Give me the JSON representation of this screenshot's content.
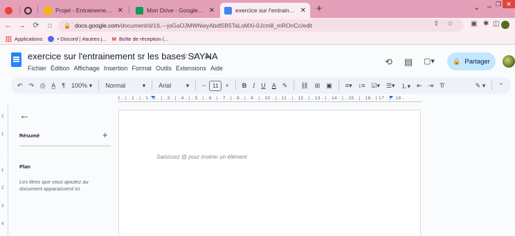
{
  "browser": {
    "tabs": [
      {
        "title": "Projet - Entrainement sur les ba...",
        "active": false,
        "favicon_color": "#f4b400"
      },
      {
        "title": "Mon Drive - Google Drive",
        "active": false,
        "favicon_color": "#0f9d58"
      },
      {
        "title": "exercice sur l'entrainement sr les",
        "active": true,
        "favicon_color": "#4285f4"
      }
    ],
    "url_host": "docs.google.com",
    "url_path": "/document/d/1IL---joGaOJMWNwyAbdt5B5TaLsMXi-0Jcm8_mROnCc/edit",
    "bookmarks": [
      {
        "label": "Applications",
        "color": "#ea4335"
      },
      {
        "label": "• Discord | #autres j...",
        "color": "#5865f2"
      },
      {
        "label": "Boîte de réception (...",
        "color": "#d93025"
      }
    ]
  },
  "doc": {
    "title": "exercice sur l'entrainement sr les bases SAYNA",
    "menu": [
      "Fichier",
      "Édition",
      "Affichage",
      "Insertion",
      "Format",
      "Outils",
      "Extensions",
      "Aide"
    ],
    "share_label": "Partager"
  },
  "toolbar": {
    "zoom": "100%",
    "style": "Normal",
    "font": "Arial",
    "font_size": "11"
  },
  "ruler": {
    "numbers": "1 . | . 1 . | . 1 . 2 . | . 3 . | . 4 . | . 5 . | . 6 . | . 7 . | . 8 . | . 9 . | . 10 . | . 11 . | . 12 . | . 13 . | . 14 . | . 15 . | . 16 . | 17 . | . 18 ."
  },
  "outline": {
    "summary_label": "Résumé",
    "plan_label": "Plan",
    "plan_hint": "Les titres que vous ajoutez au document apparaissent ici."
  },
  "page": {
    "placeholder": "Saisissez @ pour insérer un élément"
  },
  "colors": {
    "tab_strip": "#e4a0b8",
    "share_button": "#c2e7ff",
    "docs_blue": "#2684fc"
  }
}
